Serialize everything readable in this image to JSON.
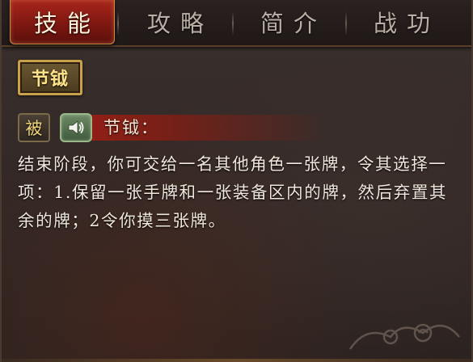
{
  "tabs": [
    {
      "label": "技能",
      "active": true
    },
    {
      "label": "攻略",
      "active": false
    },
    {
      "label": "简介",
      "active": false
    },
    {
      "label": "战功",
      "active": false
    }
  ],
  "skill": {
    "badge": "节钺",
    "type_badge": "被",
    "title": "节钺：",
    "description": "结束阶段，你可交给一名其他角色一张牌，令其选择一项：1.保留一张手牌和一张装备区内的牌，然后弃置其余的牌；2令你摸三张牌。"
  },
  "icons": {
    "voice": "speaker-icon",
    "decoration": "cloud-swirl-icon"
  },
  "colors": {
    "active_tab": "#8e1c14",
    "badge_gold": "#c9a14a",
    "speaker_green": "#5a7a52",
    "text": "#f0e8dc"
  }
}
